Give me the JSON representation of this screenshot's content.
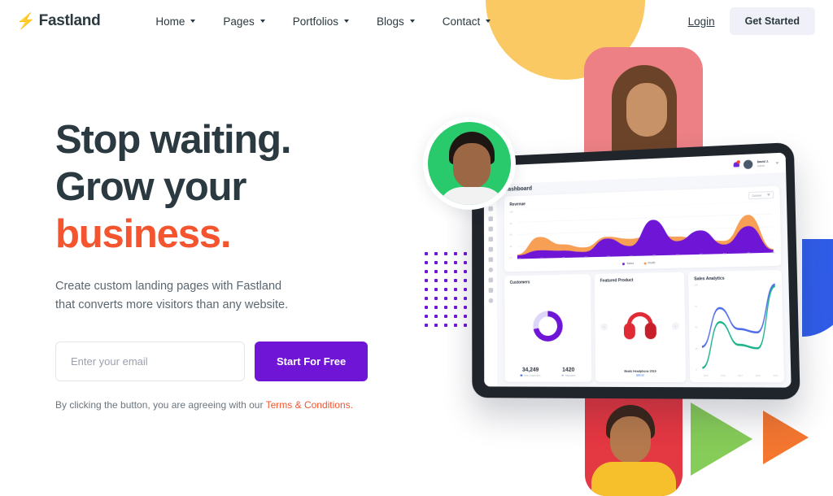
{
  "brand": {
    "name": "Fastland",
    "bolt_icon": "lightning-bolt-icon"
  },
  "header": {
    "nav": [
      {
        "label": "Home"
      },
      {
        "label": "Pages"
      },
      {
        "label": "Portfolios"
      },
      {
        "label": "Blogs"
      },
      {
        "label": "Contact"
      }
    ],
    "login_label": "Login",
    "get_started_label": "Get Started"
  },
  "hero": {
    "headline_line1": "Stop waiting.",
    "headline_line2": "Grow your",
    "headline_accent": "business.",
    "subtitle_line1": "Create custom landing pages with Fastland",
    "subtitle_line2": "that converts more visitors than any website.",
    "email_placeholder": "Enter your email",
    "email_value": "",
    "cta_label": "Start For Free",
    "terms_prefix": "By clicking the button, you are agreeing with our ",
    "terms_link": "Terms & Conditions."
  },
  "dashboard": {
    "page_title": "Dashboard",
    "user": {
      "name": "David J.",
      "role": "Admin"
    },
    "revenue": {
      "title": "Revenue",
      "period": "October",
      "legend": [
        {
          "label": "Sales",
          "color": "#6f16d6"
        },
        {
          "label": "Profit",
          "color": "#f79a4b"
        }
      ],
      "y_ticks": [
        "100",
        "80",
        "60",
        "40",
        "20"
      ],
      "x_ticks": [
        "5k",
        "10k",
        "15k",
        "20k",
        "25k",
        "30k",
        "35k",
        "40k",
        "45k",
        "50k",
        "55k",
        "60k"
      ]
    },
    "customers": {
      "title": "Customers",
      "stats": [
        {
          "value": "34,249",
          "label": "New Customers",
          "color": "#2f5ce8"
        },
        {
          "value": "1420",
          "label": "Repeated",
          "color": "#b9c3e8"
        }
      ],
      "donut_percent": 72
    },
    "featured_product": {
      "title": "Featured Product",
      "name": "Beats Headphone 2019",
      "price": "$99.00",
      "prev_icon": "chevron-left-icon",
      "next_icon": "chevron-right-icon"
    },
    "sales_analytics": {
      "title": "Sales Analytics",
      "y_ticks": [
        "100",
        "75",
        "50",
        "25",
        "0"
      ],
      "x_ticks": [
        "2015",
        "2016",
        "2017",
        "2018",
        "2019"
      ]
    }
  },
  "chart_data": [
    {
      "type": "area",
      "title": "Revenue",
      "xlabel": "",
      "ylabel": "",
      "ylim": [
        0,
        110
      ],
      "grid": true,
      "legend_position": "bottom",
      "x": [
        "5k",
        "10k",
        "15k",
        "20k",
        "25k",
        "30k",
        "35k",
        "40k",
        "45k",
        "50k",
        "55k",
        "60k"
      ],
      "series": [
        {
          "name": "Sales",
          "color": "#6f16d6",
          "values": [
            8,
            18,
            16,
            12,
            40,
            22,
            78,
            30,
            52,
            20,
            58,
            6
          ]
        },
        {
          "name": "Profit",
          "color": "#f79a4b",
          "values": [
            10,
            48,
            30,
            22,
            44,
            38,
            46,
            40,
            34,
            28,
            82,
            8
          ]
        }
      ]
    },
    {
      "type": "pie",
      "title": "Customers",
      "labels": [
        "New Customers",
        "Repeated"
      ],
      "values": [
        72,
        28
      ],
      "colors": [
        "#6f16d6",
        "#ddd6f7"
      ]
    },
    {
      "type": "line",
      "title": "Sales Analytics",
      "x": [
        "2015",
        "2016",
        "2017",
        "2018",
        "2019"
      ],
      "ylim": [
        0,
        100
      ],
      "grid": false,
      "series": [
        {
          "name": "series-blue",
          "color": "#4f6bea",
          "values": [
            28,
            72,
            48,
            44,
            98
          ]
        },
        {
          "name": "series-teal",
          "color": "#19b18a",
          "values": [
            4,
            56,
            30,
            26,
            96
          ]
        }
      ]
    }
  ]
}
